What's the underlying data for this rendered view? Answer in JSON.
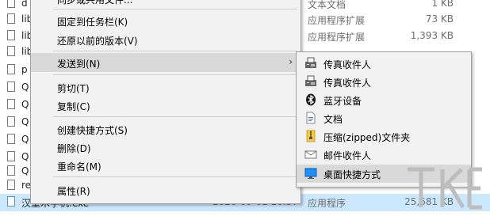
{
  "files": [
    {
      "name": "d",
      "type": "文本文档",
      "size": "1 KB",
      "icon": "text-file-icon"
    },
    {
      "name": "lib",
      "type": "应用程序扩展",
      "size": "73 KB",
      "icon": "dll-file-icon"
    },
    {
      "name": "lib",
      "type": "应用程序扩展",
      "size": "1,393 KB",
      "icon": "dll-file-icon"
    },
    {
      "name": "lib",
      "type": "",
      "size": "",
      "icon": "dll-file-icon"
    },
    {
      "name": "p",
      "type": "",
      "size": "",
      "icon": "dll-file-icon"
    },
    {
      "name": "Q",
      "type": "",
      "size": "",
      "icon": "dll-file-icon"
    },
    {
      "name": "Q",
      "type": "",
      "size": "",
      "icon": "dll-file-icon"
    },
    {
      "name": "Q",
      "type": "",
      "size": "",
      "icon": "dll-file-icon"
    },
    {
      "name": "Q",
      "type": "",
      "size": "",
      "icon": "dll-file-icon"
    },
    {
      "name": "Q",
      "type": "",
      "size": "",
      "icon": "dll-file-icon"
    },
    {
      "name": "Q",
      "type": "",
      "size": "",
      "icon": "dll-file-icon"
    },
    {
      "name": "re",
      "type": "",
      "size": "",
      "icon": "text-file-icon"
    }
  ],
  "selected_file": {
    "name": "汉堡木字机.exe",
    "date": "2020-09-01 10:57",
    "type": "应用程序",
    "size": "25,681 KB"
  },
  "context_menu": {
    "top_partial": "同步或共用文件...",
    "items": [
      {
        "label": "固定到任务栏(K)"
      },
      {
        "label": "还原以前的版本(V)"
      },
      {
        "label": "发送到(N)"
      },
      {
        "label": "剪切(T)"
      },
      {
        "label": "复制(C)"
      },
      {
        "label": "创建快捷方式(S)"
      },
      {
        "label": "删除(D)"
      },
      {
        "label": "重命名(M)"
      },
      {
        "label": "属性(R)"
      }
    ],
    "submenu_arrow": "›"
  },
  "send_to_menu": {
    "items": [
      {
        "label": "传真收件人",
        "icon": "fax-icon"
      },
      {
        "label": "传真收件人",
        "icon": "fax-icon"
      },
      {
        "label": "蓝牙设备",
        "icon": "bluetooth-icon"
      },
      {
        "label": "文档",
        "icon": "documents-icon"
      },
      {
        "label": "压缩(zipped)文件夹",
        "icon": "zip-folder-icon"
      },
      {
        "label": "邮件收件人",
        "icon": "mail-icon"
      },
      {
        "label": "桌面快捷方式",
        "icon": "desktop-icon"
      }
    ]
  },
  "colors": {
    "menu_bg": "#f2f2f2",
    "hover_bg": "#d9d9d9",
    "selected_row": "#cce8ff"
  }
}
